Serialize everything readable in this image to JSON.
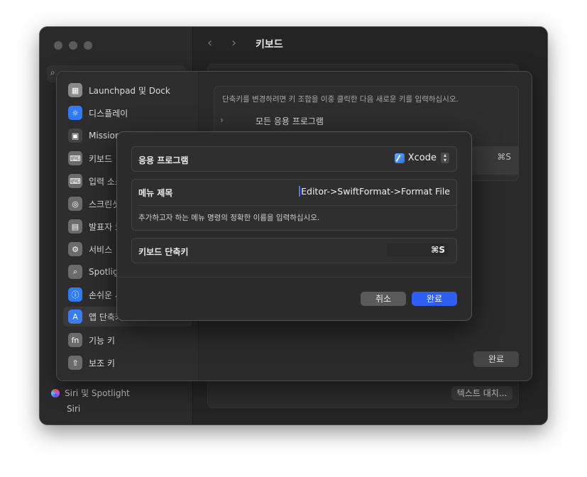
{
  "window": {
    "header_title": "키보드",
    "sidebar_bottom": [
      {
        "label": "Siri 및 Spotlight"
      },
      {
        "label": "Siri"
      }
    ],
    "bg_buttons": {
      "text_replace": "텍스트 대치..."
    }
  },
  "sheet": {
    "hint": "단축키를 변경하려면 키 조합을 이중 클릭한 다음 새로운 키를 입력하십시오.",
    "all_apps": "모든 응용 프로그램",
    "selected_shortcut": "⌘S",
    "done_label": "완료",
    "items": [
      {
        "label": "Launchpad 및 Dock",
        "icon": "launchpad-icon",
        "color": "#8a8a8a"
      },
      {
        "label": "디스플레이",
        "icon": "display-icon",
        "color": "#2f7bf5"
      },
      {
        "label": "Mission Control",
        "icon": "mission-control-icon",
        "color": "#444444"
      },
      {
        "label": "키보드",
        "icon": "keyboard-icon",
        "color": "#6b6b6b"
      },
      {
        "label": "입력 소스",
        "icon": "input-source-icon",
        "color": "#6b6b6b"
      },
      {
        "label": "스크린샷",
        "icon": "screenshot-icon",
        "color": "#6b6b6b"
      },
      {
        "label": "발표자 오버레이",
        "icon": "presenter-icon",
        "color": "#6b6b6b"
      },
      {
        "label": "서비스",
        "icon": "services-icon",
        "color": "#6b6b6b"
      },
      {
        "label": "Spotlight",
        "icon": "spotlight-icon",
        "color": "#6b6b6b"
      },
      {
        "label": "손쉬운 사용",
        "icon": "accessibility-icon",
        "color": "#2f7bf5"
      },
      {
        "label": "앱 단축키",
        "icon": "app-shortcuts-icon",
        "color": "#3a7bf0"
      },
      {
        "label": "기능 키",
        "icon": "fn-key-icon",
        "color": "#6b6b6b"
      },
      {
        "label": "보조 키",
        "icon": "modifier-key-icon",
        "color": "#6b6b6b"
      }
    ]
  },
  "dialog": {
    "app_label": "응용 프로그램",
    "app_value": "Xcode",
    "menu_title_label": "메뉴 제목",
    "menu_title_value": "Editor->SwiftFormat->Format File",
    "menu_helper": "추가하고자 하는 메뉴 명령의 정확한 이름을 입력하십시오.",
    "shortcut_label": "키보드 단축키",
    "shortcut_value": "⌘S",
    "cancel_label": "취소",
    "ok_label": "완료"
  }
}
